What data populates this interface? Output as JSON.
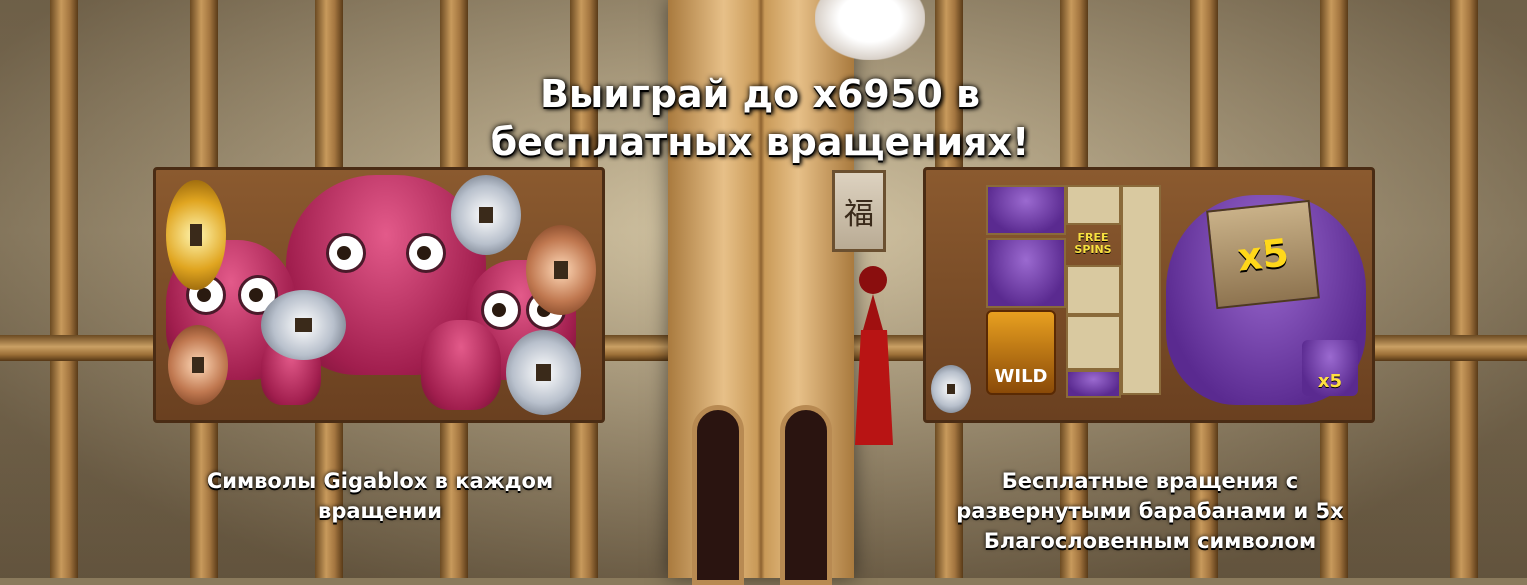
{
  "headline": "Выиграй до x6950 в бесплатных вращениях!",
  "features": [
    {
      "caption": "Символы Gigablox в каждом вращении"
    },
    {
      "caption": "Бесплатные вращения с развернутыми барабанами и 5x Благословенным символом",
      "symbols": {
        "wild": "WILD",
        "free_spins": "FREE SPINS",
        "multiplier_big": "x5",
        "multiplier_small": "x5"
      }
    }
  ],
  "lantern_glyph": "福",
  "colors": {
    "headline_text": "#ffffff",
    "daruma_red": "#a11e4e",
    "daruma_purple": "#5a2a90",
    "multiplier_gold": "#ffd81a"
  },
  "icons": [
    "lucky-cat-icon",
    "fortune-tag-icon",
    "red-tassel-icon",
    "coin-icon",
    "daruma-icon"
  ]
}
